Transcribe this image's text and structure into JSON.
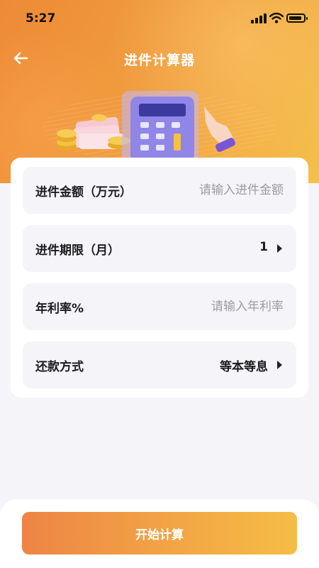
{
  "status_bar": {
    "time": "5:27"
  },
  "nav": {
    "title": "进件计算器",
    "back_icon": "arrow-left-icon"
  },
  "form": {
    "amount": {
      "label": "进件金额（万元）",
      "placeholder": "请输入进件金额",
      "value": ""
    },
    "term": {
      "label": "进件期限（月）",
      "value": "1"
    },
    "rate": {
      "label": "年利率%",
      "placeholder": "请输入年利率",
      "value": ""
    },
    "repayment": {
      "label": "还款方式",
      "value": "等本等息"
    }
  },
  "actions": {
    "start_label": "开始计算"
  },
  "colors": {
    "accent_start": "#ee8445",
    "accent_end": "#f5bd45",
    "page_bg": "#f5f5f9"
  }
}
